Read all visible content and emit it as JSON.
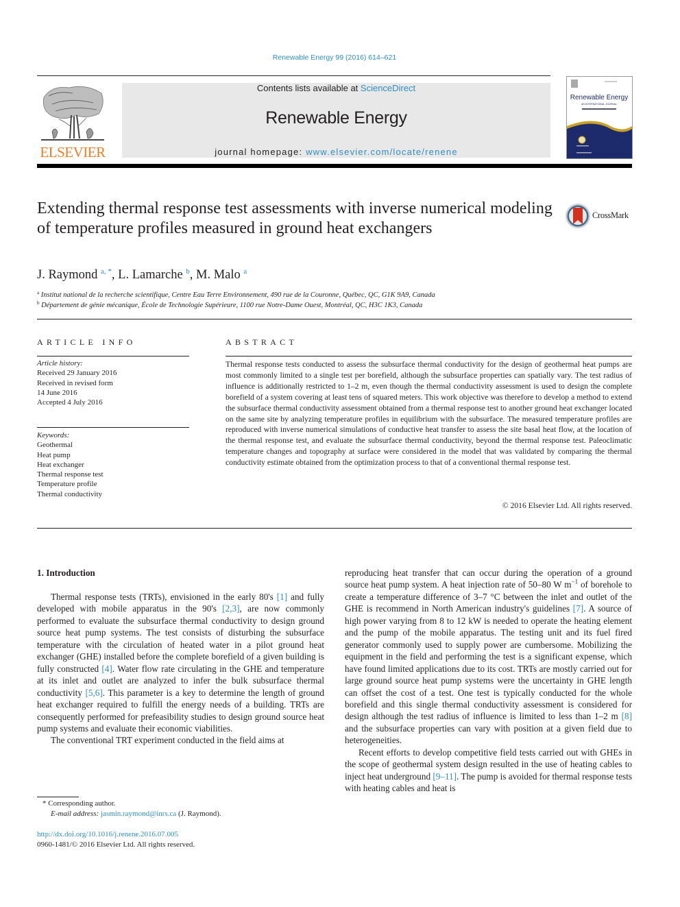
{
  "header": {
    "journal_ref": "Renewable Energy 99 (2016) 614–621",
    "contents_prefix": "Contents lists available at ",
    "contents_link": "ScienceDirect",
    "journal_title": "Renewable Energy",
    "homepage_prefix": "journal homepage: ",
    "homepage_link": "www.elsevier.com/locate/renene",
    "publisher_logo": "ELSEVIER",
    "cover": {
      "title": "Renewable Energy",
      "subtitle": "AN INTERNATIONAL JOURNAL"
    }
  },
  "article": {
    "title": "Extending thermal response test assessments with inverse numerical modeling of temperature profiles measured in ground heat exchangers",
    "crossmark_label": "CrossMark",
    "authors": [
      {
        "name": "J. Raymond",
        "sup": "a, *"
      },
      {
        "name": "L. Lamarche",
        "sup": "b"
      },
      {
        "name": "M. Malo",
        "sup": "a"
      }
    ],
    "affiliations": [
      {
        "mark": "a",
        "text": "Institut national de la recherche scientifique, Centre Eau Terre Environnement, 490 rue de la Couronne, Québec, QC, G1K 9A9, Canada"
      },
      {
        "mark": "b",
        "text": "Département de génie mécanique, École de Technologie Supérieure, 1100 rue Notre-Dame Ouest, Montréal, QC, H3C 1K3, Canada"
      }
    ]
  },
  "article_info": {
    "heading": "ARTICLE INFO",
    "history_label": "Article history:",
    "history": [
      "Received 29 January 2016",
      "Received in revised form",
      "14 June 2016",
      "Accepted 4 July 2016"
    ],
    "keywords_label": "Keywords:",
    "keywords": [
      "Geothermal",
      "Heat pump",
      "Heat exchanger",
      "Thermal response test",
      "Temperature profile",
      "Thermal conductivity"
    ]
  },
  "abstract": {
    "heading": "ABSTRACT",
    "text": "Thermal response tests conducted to assess the subsurface thermal conductivity for the design of geothermal heat pumps are most commonly limited to a single test per borefield, although the sub­surface properties can spatially vary. The test radius of influence is additionally restricted to 1–2 m, even though the thermal conductivity assessment is used to design the complete borefield of a system covering at least tens of squared meters. This work objective was therefore to develop a method to extend the subsurface thermal conductivity assessment obtained from a thermal response test to another ground heat exchanger located on the same site by analyzing temperature profiles in equilibrium with the subsurface. The measured temperature profiles are reproduced with inverse numerical simulations of conductive heat transfer to assess the site basal heat flow, at the location of the thermal response test, and evaluate the subsurface thermal conductivity, beyond the thermal response test. Paleoclimatic temperature changes and topography at surface were considered in the model that was validated by comparing the thermal conductivity estimate obtained from the optimization process to that of a con­ventional thermal response test.",
    "copyright": "© 2016 Elsevier Ltd. All rights reserved."
  },
  "introduction": {
    "heading": "1.  Introduction",
    "left_p1": [
      {
        "t": "Thermal response tests (TRTs), envisioned in the early 80's "
      },
      {
        "t": "[1]",
        "ref": true
      },
      {
        "t": " and fully developed with mobile apparatus in the 90's "
      },
      {
        "t": "[2,3]",
        "ref": true
      },
      {
        "t": ", are now commonly performed to evaluate the subsurface thermal conductivity to design ground source heat pump systems. The test consists of disturbing the subsurface temperature with the circu­lation of heated water in a pilot ground heat exchanger (GHE) installed before the complete borefield of a given building is fully constructed "
      },
      {
        "t": "[4]",
        "ref": true
      },
      {
        "t": ". Water flow rate circulating in the GHE and tem­perature at its inlet and outlet are analyzed to infer the bulk sub­surface thermal conductivity "
      },
      {
        "t": "[5,6]",
        "ref": true
      },
      {
        "t": ". This parameter is a key to determine the length of ground heat exchanger required to fulfill the energy needs of a building. TRTs are consequently performed for prefeasibility studies to design ground source heat pump sys­tems and evaluate their economic viabilities."
      }
    ],
    "left_p2": "The conventional TRT experiment conducted in the field aims at",
    "right_p1": [
      {
        "t": "reproducing heat transfer that can occur during the operation of a ground source heat pump system. A heat injection rate of 50–80 W m"
      },
      {
        "t": "−1",
        "sup": true
      },
      {
        "t": " of borehole to create a temperature difference of 3–7 °C between the inlet and outlet of the GHE is recommend in North American industry's guidelines "
      },
      {
        "t": "[7]",
        "ref": true
      },
      {
        "t": ". A source of high power varying from 8 to 12 kW is needed to operate the heating element and the pump of the mobile apparatus. The testing unit and its fuel fired generator commonly used to supply power are cumbersome. Mobilizing the equipment in the field and performing the test is a significant expense, which have found limited applications due to its cost. TRTs are mostly carried out for large ground source heat pump systems were the uncertainty in GHE length can offset the cost of a test. One test is typically conducted for the whole borefield and this single thermal conductivity assessment is considered for design although the test radius of influence is limited to less than 1–2 m "
      },
      {
        "t": "[8]",
        "ref": true
      },
      {
        "t": " and the subsurface properties can vary with position at a given field due to heterogeneities."
      }
    ],
    "right_p2": [
      {
        "t": "Recent efforts to develop competitive field tests carried out with GHEs in the scope of geothermal system design resulted in the use of heating cables to inject heat underground "
      },
      {
        "t": "[9–11]",
        "ref": true
      },
      {
        "t": ". The pump is avoided for thermal response tests with heating cables and heat is"
      }
    ]
  },
  "footnotes": {
    "corresponding": "*  Corresponding author.",
    "email_label": "E-mail address: ",
    "email": "jasmin.raymond@inrs.ca",
    "email_suffix": " (J. Raymond).",
    "doi": "http://dx.doi.org/10.1016/j.renene.2016.07.005",
    "issn": "0960-1481/© 2016 Elsevier Ltd. All rights reserved."
  },
  "colors": {
    "link": "#2e8ec3",
    "elsevier_orange": "#f47b20",
    "banner_gray": "#e8e8e8",
    "text": "#231f20"
  }
}
